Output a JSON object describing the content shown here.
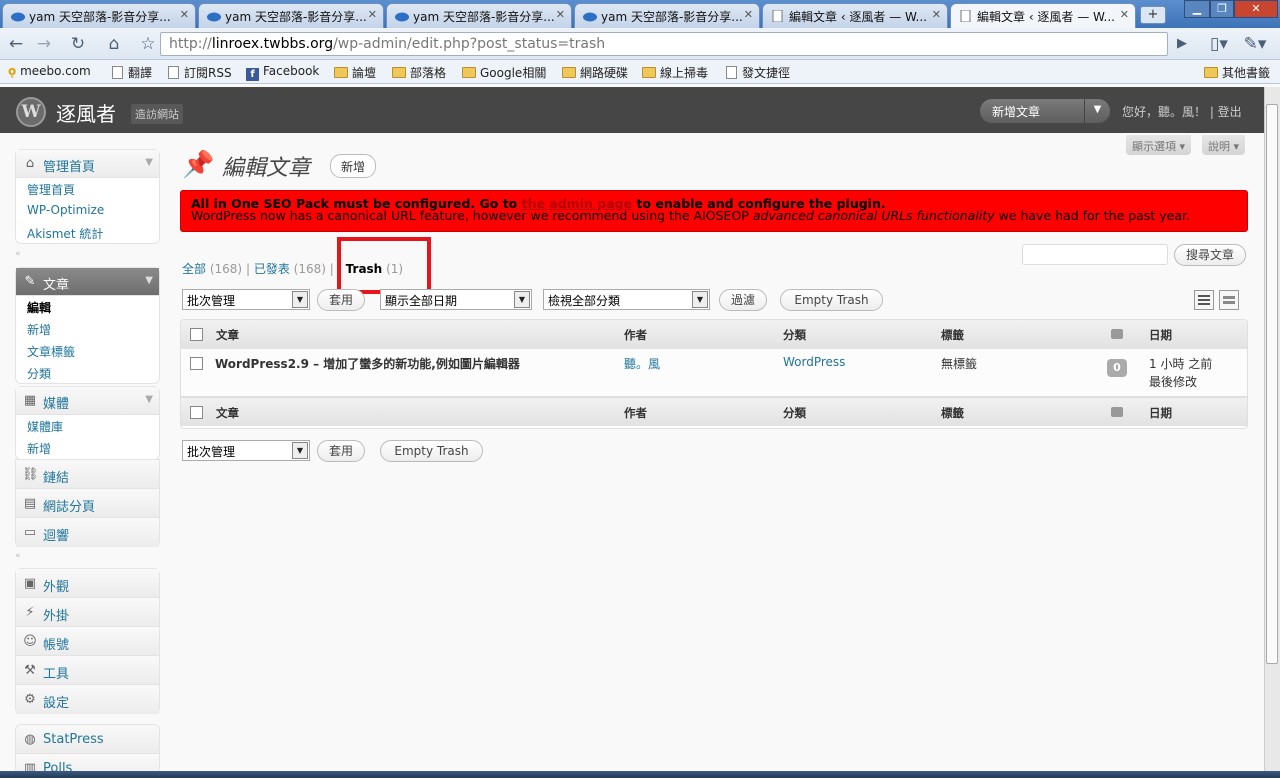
{
  "browser": {
    "tabs": [
      {
        "title": "yam 天空部落-影音分享..."
      },
      {
        "title": "yam 天空部落-影音分享..."
      },
      {
        "title": "yam 天空部落-影音分享..."
      },
      {
        "title": "yam 天空部落-影音分享..."
      },
      {
        "title": "編輯文章 ‹ 逐風者 — W..."
      },
      {
        "title": "編輯文章 ‹ 逐風者 — W..."
      }
    ],
    "url_prefix": "http://",
    "url_host": "linroex.twbbs.org",
    "url_path": "/wp-admin/edit.php?post_status=trash",
    "bookmarks": [
      "meebo.com",
      "翻譯",
      "訂閱RSS",
      "Facebook",
      "論壇",
      "部落格",
      "Google相關",
      "網路硬碟",
      "線上掃毒",
      "發文捷徑"
    ],
    "other_bookmarks": "其他書籤"
  },
  "wp_header": {
    "site_name": "逐風者",
    "visit_site": "造訪網站",
    "favorite_action": "新增文章",
    "greeting": "您好，聽。風！ | 登出"
  },
  "screen_buttons": {
    "options": "顯示選項 ▾",
    "help": "說明 ▾"
  },
  "sidebar": {
    "dashboard": {
      "label": "管理首頁",
      "items": [
        "管理首頁",
        "WP-Optimize",
        "Akismet 統計"
      ]
    },
    "posts": {
      "label": "文章",
      "items": [
        "編輯",
        "新增",
        "文章標籤",
        "分類"
      ]
    },
    "media": {
      "label": "媒體",
      "items": [
        "媒體庫",
        "新增"
      ]
    },
    "links": "鏈結",
    "pages": "網誌分頁",
    "comments": "迴響",
    "appearance": "外觀",
    "plugins": "外掛",
    "users": "帳號",
    "tools": "工具",
    "settings": "設定",
    "statpress": "StatPress",
    "polls": "Polls"
  },
  "page": {
    "title": "編輯文章",
    "add_new": "新增"
  },
  "notice": {
    "line1_pre": "All in One SEO Pack must be configured. Go to",
    "line1_link": "the admin page",
    "line1_post": "to enable and configure the plugin.",
    "line2_pre": "WordPress now has a canonical URL feature, however we recommend using the AIOSEOP",
    "line2_em": "advanced canonical URLs functionality",
    "line2_post": "we have had for the past year."
  },
  "filters": {
    "all": "全部",
    "all_count": "(168)",
    "published": "已發表",
    "published_count": "(168)",
    "trash": "Trash",
    "trash_count": "(1)",
    "sep": "|"
  },
  "search_button": "搜尋文章",
  "actions": {
    "bulk": "批次管理",
    "apply": "套用",
    "dates": "顯示全部日期",
    "cats": "檢視全部分類",
    "filter": "過濾",
    "empty_trash": "Empty Trash"
  },
  "table": {
    "columns": {
      "post": "文章",
      "author": "作者",
      "category": "分類",
      "tags": "標籤",
      "date": "日期"
    },
    "rows": [
      {
        "title": "WordPress2.9 – 增加了蠻多的新功能,例如圖片編輯器",
        "author": "聽。風",
        "category": "WordPress",
        "tags": "無標籤",
        "comments": "0",
        "date": "1 小時 之前",
        "status": "最後修改"
      }
    ]
  }
}
